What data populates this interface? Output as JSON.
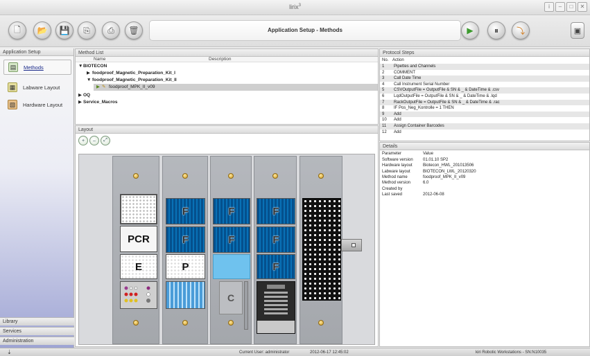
{
  "window": {
    "title": "lirix",
    "title_sup": "3",
    "buttons": [
      "i",
      "–",
      "□",
      "✕"
    ]
  },
  "toolbar": {
    "banner": "Application Setup - Methods"
  },
  "sidebar": {
    "header": "Application Setup",
    "items": [
      {
        "label": "Methods",
        "icon": "methods-icon"
      },
      {
        "label": "Labware Layout",
        "icon": "labware-icon"
      },
      {
        "label": "Hardware Layout",
        "icon": "hardware-icon"
      }
    ],
    "footer": [
      "Library",
      "Services",
      "Administration"
    ]
  },
  "method_list": {
    "header": "Method List",
    "columns": {
      "name": "Name",
      "description": "Description"
    },
    "rows": [
      {
        "text": "BIOTECON",
        "prefix": "▼"
      },
      {
        "text": "foodproof_Magnetic_Preparation_Kit_I",
        "prefix": "▶"
      },
      {
        "text": "foodproof_Magnetic_Preparation_Kit_II",
        "prefix": "▼"
      },
      {
        "text": "foodproof_MPK_II_v09",
        "prefix": "▶"
      },
      {
        "text": "OQ",
        "prefix": "▶"
      },
      {
        "text": "Service_Macros",
        "prefix": "▶"
      }
    ]
  },
  "layout": {
    "header": "Layout",
    "zoom_buttons": [
      "+",
      "–",
      "⤢"
    ],
    "plate_labels": {
      "f": "F",
      "pcr": "PCR",
      "e": "E",
      "p": "P",
      "c": "C"
    }
  },
  "protocol": {
    "header": "Protocol Steps",
    "columns": {
      "no": "No.",
      "action": "Action"
    },
    "steps": [
      {
        "no": "1",
        "action": "Pipettes and Channels"
      },
      {
        "no": "2",
        "action": "COMMENT"
      },
      {
        "no": "3",
        "action": "Call Date Time"
      },
      {
        "no": "4",
        "action": "Call Instrument Serial Number"
      },
      {
        "no": "5",
        "action": "CSVOutputFile = OutputFile & SN & _ & DateTime & .csv"
      },
      {
        "no": "6",
        "action": "LqdOutputFile = OutputFile & SN & _ & DateTime & .lqd"
      },
      {
        "no": "7",
        "action": "RackOutputFile = OutputFile & SN & _ & DateTime & .rac"
      },
      {
        "no": "8",
        "action": "IF Pos_Neg_Kontrolle = 1 THEN"
      },
      {
        "no": "9",
        "action": "Add"
      },
      {
        "no": "10",
        "action": "Add"
      },
      {
        "no": "11",
        "action": "Assign Container Barcodes"
      },
      {
        "no": "12",
        "action": "Add"
      }
    ]
  },
  "details": {
    "header": "Details",
    "columns": {
      "param": "Parameter",
      "value": "Value"
    },
    "rows": [
      {
        "k": "Software version",
        "v": "01.01.10 SP2"
      },
      {
        "k": "Hardware layout",
        "v": "Biotecon_HWL_201013506"
      },
      {
        "k": "Labware layout",
        "v": "BIOTECON_LWL_20120320"
      },
      {
        "k": "Method name",
        "v": "foodproof_MPK_II_v09"
      },
      {
        "k": "Method version",
        "v": "6.0"
      },
      {
        "k": "Created by",
        "v": ""
      },
      {
        "k": "Last saved",
        "v": "2012-06-08"
      }
    ]
  },
  "status": {
    "user": "Current User: administrator",
    "datetime": "2012-06-17  12:45:02",
    "workstation": "kiri Robotic Workstations - SN:N10035"
  }
}
